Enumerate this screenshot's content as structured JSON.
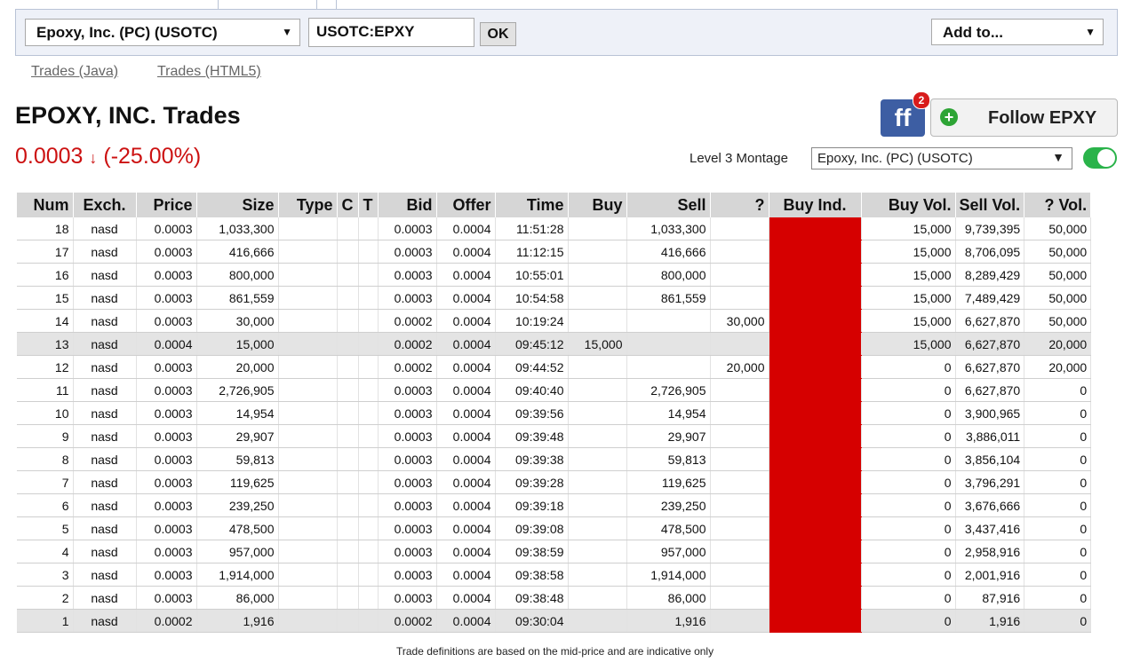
{
  "company_select": {
    "value": "Epoxy, Inc. (PC) (USOTC)"
  },
  "symbol_input": {
    "value": "USOTC:EPXY"
  },
  "ok_label": "OK",
  "add_to": {
    "value": "Add to..."
  },
  "links": {
    "java": "Trades (Java)",
    "html5": "Trades (HTML5)"
  },
  "title": "EPOXY, INC. Trades",
  "price": {
    "value": "0.0003",
    "arrow": "↓",
    "change": "(-25.00%)",
    "color": "#cc1111"
  },
  "ff": {
    "label": "ff",
    "badge": "2"
  },
  "follow": {
    "label": "Follow EPXY"
  },
  "level3": {
    "label": "Level 3 Montage",
    "select": "Epoxy, Inc. (PC) (USOTC)"
  },
  "table": {
    "headers": [
      "Num",
      "Exch.",
      "Price",
      "Size",
      "Type",
      "C",
      "T",
      "Bid",
      "Offer",
      "Time",
      "Buy",
      "Sell",
      "?",
      "Buy Ind.",
      "Buy Vol.",
      "Sell Vol.",
      "? Vol."
    ],
    "rows": [
      [
        "18",
        "nasd",
        "0.0003",
        "1,033,300",
        "",
        "",
        "",
        "0.0003",
        "0.0004",
        "11:51:28",
        "",
        "1,033,300",
        "",
        "",
        "15,000",
        "9,739,395",
        "50,000"
      ],
      [
        "17",
        "nasd",
        "0.0003",
        "416,666",
        "",
        "",
        "",
        "0.0003",
        "0.0004",
        "11:12:15",
        "",
        "416,666",
        "",
        "",
        "15,000",
        "8,706,095",
        "50,000"
      ],
      [
        "16",
        "nasd",
        "0.0003",
        "800,000",
        "",
        "",
        "",
        "0.0003",
        "0.0004",
        "10:55:01",
        "",
        "800,000",
        "",
        "",
        "15,000",
        "8,289,429",
        "50,000"
      ],
      [
        "15",
        "nasd",
        "0.0003",
        "861,559",
        "",
        "",
        "",
        "0.0003",
        "0.0004",
        "10:54:58",
        "",
        "861,559",
        "",
        "",
        "15,000",
        "7,489,429",
        "50,000"
      ],
      [
        "14",
        "nasd",
        "0.0003",
        "30,000",
        "",
        "",
        "",
        "0.0002",
        "0.0004",
        "10:19:24",
        "",
        "",
        "30,000",
        "",
        "15,000",
        "6,627,870",
        "50,000"
      ],
      [
        "13",
        "nasd",
        "0.0004",
        "15,000",
        "",
        "",
        "",
        "0.0002",
        "0.0004",
        "09:45:12",
        "15,000",
        "",
        "",
        "",
        "15,000",
        "6,627,870",
        "20,000"
      ],
      [
        "12",
        "nasd",
        "0.0003",
        "20,000",
        "",
        "",
        "",
        "0.0002",
        "0.0004",
        "09:44:52",
        "",
        "",
        "20,000",
        "",
        "0",
        "6,627,870",
        "20,000"
      ],
      [
        "11",
        "nasd",
        "0.0003",
        "2,726,905",
        "",
        "",
        "",
        "0.0003",
        "0.0004",
        "09:40:40",
        "",
        "2,726,905",
        "",
        "",
        "0",
        "6,627,870",
        "0"
      ],
      [
        "10",
        "nasd",
        "0.0003",
        "14,954",
        "",
        "",
        "",
        "0.0003",
        "0.0004",
        "09:39:56",
        "",
        "14,954",
        "",
        "",
        "0",
        "3,900,965",
        "0"
      ],
      [
        "9",
        "nasd",
        "0.0003",
        "29,907",
        "",
        "",
        "",
        "0.0003",
        "0.0004",
        "09:39:48",
        "",
        "29,907",
        "",
        "",
        "0",
        "3,886,011",
        "0"
      ],
      [
        "8",
        "nasd",
        "0.0003",
        "59,813",
        "",
        "",
        "",
        "0.0003",
        "0.0004",
        "09:39:38",
        "",
        "59,813",
        "",
        "",
        "0",
        "3,856,104",
        "0"
      ],
      [
        "7",
        "nasd",
        "0.0003",
        "119,625",
        "",
        "",
        "",
        "0.0003",
        "0.0004",
        "09:39:28",
        "",
        "119,625",
        "",
        "",
        "0",
        "3,796,291",
        "0"
      ],
      [
        "6",
        "nasd",
        "0.0003",
        "239,250",
        "",
        "",
        "",
        "0.0003",
        "0.0004",
        "09:39:18",
        "",
        "239,250",
        "",
        "",
        "0",
        "3,676,666",
        "0"
      ],
      [
        "5",
        "nasd",
        "0.0003",
        "478,500",
        "",
        "",
        "",
        "0.0003",
        "0.0004",
        "09:39:08",
        "",
        "478,500",
        "",
        "",
        "0",
        "3,437,416",
        "0"
      ],
      [
        "4",
        "nasd",
        "0.0003",
        "957,000",
        "",
        "",
        "",
        "0.0003",
        "0.0004",
        "09:38:59",
        "",
        "957,000",
        "",
        "",
        "0",
        "2,958,916",
        "0"
      ],
      [
        "3",
        "nasd",
        "0.0003",
        "1,914,000",
        "",
        "",
        "",
        "0.0003",
        "0.0004",
        "09:38:58",
        "",
        "1,914,000",
        "",
        "",
        "0",
        "2,001,916",
        "0"
      ],
      [
        "2",
        "nasd",
        "0.0003",
        "86,000",
        "",
        "",
        "",
        "0.0003",
        "0.0004",
        "09:38:48",
        "",
        "86,000",
        "",
        "",
        "0",
        "87,916",
        "0"
      ],
      [
        "1",
        "nasd",
        "0.0002",
        "1,916",
        "",
        "",
        "",
        "0.0002",
        "0.0004",
        "09:30:04",
        "",
        "1,916",
        "",
        "",
        "0",
        "1,916",
        "0"
      ]
    ],
    "shaded_rows": [
      5,
      17
    ],
    "buy_ind_color": "#d60000"
  },
  "footnote": "Trade definitions are based on the mid-price and are indicative only"
}
